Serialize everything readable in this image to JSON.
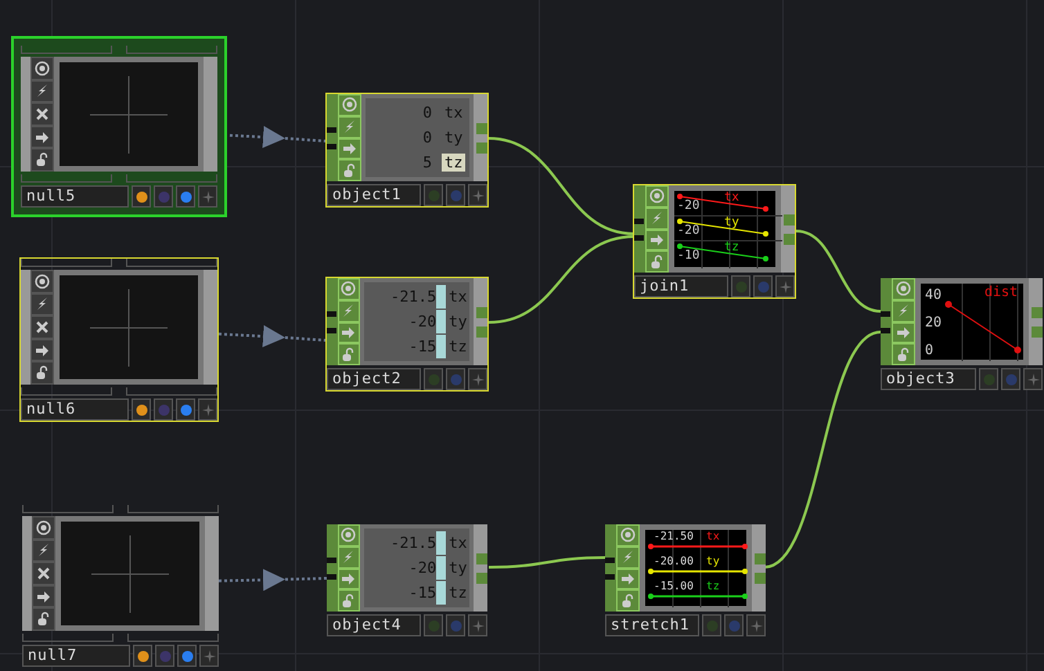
{
  "nodes": [
    {
      "kind": "null",
      "name": "null5",
      "current": true,
      "selected": true
    },
    {
      "kind": "object",
      "name": "object1",
      "current": false,
      "selected": true,
      "rows": [
        {
          "value": "0",
          "param": "tx",
          "highlighted": false
        },
        {
          "value": "0",
          "param": "ty",
          "highlighted": false
        },
        {
          "value": "5",
          "param": "tz",
          "highlighted": true
        }
      ],
      "bars": false
    },
    {
      "kind": "join",
      "name": "join1",
      "current": false,
      "selected": true,
      "channels": [
        {
          "name": "tx",
          "tick": "-20",
          "color": "#ff1a1a"
        },
        {
          "name": "ty",
          "tick": "-20",
          "color": "#e6e600"
        },
        {
          "name": "tz",
          "tick": "-10",
          "color": "#1ad01a"
        }
      ]
    },
    {
      "kind": "null",
      "name": "null6",
      "current": false,
      "selected": true
    },
    {
      "kind": "object",
      "name": "object2",
      "current": false,
      "selected": true,
      "rows": [
        {
          "value": "-21.5",
          "param": "tx",
          "highlighted": false
        },
        {
          "value": "-20",
          "param": "ty",
          "highlighted": false
        },
        {
          "value": "-15",
          "param": "tz",
          "highlighted": false
        }
      ],
      "bars": true
    },
    {
      "kind": "plot",
      "name": "object3",
      "current": false,
      "selected": false,
      "channel": {
        "name": "dist",
        "color": "#e01010"
      },
      "ticks": [
        "40",
        "20",
        "0"
      ]
    },
    {
      "kind": "null",
      "name": "null7",
      "current": false,
      "selected": false
    },
    {
      "kind": "object",
      "name": "object4",
      "current": false,
      "selected": false,
      "rows": [
        {
          "value": "-21.5",
          "param": "tx",
          "highlighted": false
        },
        {
          "value": "-20",
          "param": "ty",
          "highlighted": false
        },
        {
          "value": "-15",
          "param": "tz",
          "highlighted": false
        }
      ],
      "bars": true
    },
    {
      "kind": "stretch",
      "name": "stretch1",
      "current": false,
      "selected": false,
      "channels": [
        {
          "name": "tx",
          "value": "-21.50",
          "color": "#ff1a1a"
        },
        {
          "name": "ty",
          "value": "-20.00",
          "color": "#e6e600"
        },
        {
          "name": "tz",
          "value": "-15.00",
          "color": "#1ad01a"
        }
      ]
    }
  ]
}
